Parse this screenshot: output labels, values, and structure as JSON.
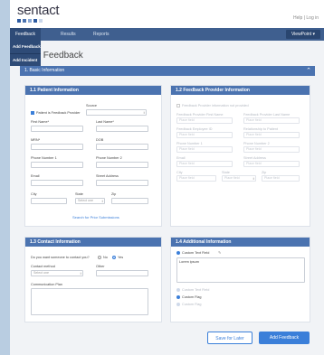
{
  "app": {
    "logo": "sentact",
    "top_links": "Help | Log in",
    "logo_colors": [
      "#2c5aa0",
      "#4b73b0",
      "#8aa9d6",
      "#2c5aa0",
      "#c9d6ea"
    ]
  },
  "nav": {
    "feedback": "Feedback",
    "results": "Results",
    "reports": "Reports",
    "viewpoint": "ViewPoint"
  },
  "dropdown": {
    "add_feedback": "Add Feedback",
    "add_incident": "Add Incident"
  },
  "page": {
    "title": "New Feedback",
    "section": "1.  Basic Information"
  },
  "patient": {
    "title": "1.1  Patient Information",
    "source_label": "Source",
    "patient_is_provider": "Patient is Feedback Provider",
    "first_name": "First Name*",
    "last_name": "Last Name*",
    "mrn": "MRN*",
    "dob": "DOB",
    "phone1": "Phone Number 1",
    "phone2": "Phone Number 2",
    "email": "Email",
    "street": "Street Address",
    "city": "City",
    "state": "State",
    "state_value": "Select one",
    "zip": "Zip",
    "search_link": "Search for Prior Submissions"
  },
  "provider": {
    "title": "1.2  Feedback Provider Information",
    "checkbox": "Feedback Provider information not provided",
    "first_name": "Feedback Provider First Name",
    "last_name": "Feedback Provider Last Name",
    "employee": "Feedback Employee ID",
    "relationship": "Relationship to Patient",
    "phone1": "Phone Number 1",
    "phone2": "Phone Number 2",
    "email": "Email",
    "street": "Street Address",
    "city": "City",
    "state": "State",
    "zip": "Zip",
    "placeholder": "Place field",
    "state_placeholder": "Place field"
  },
  "contact": {
    "title": "1.3  Contact Information",
    "question": "Do you want someone to contact you?",
    "no": "No",
    "yes": "Yes",
    "method": "Contact method",
    "method_value": "Select one",
    "other": "Other",
    "plan": "Communication Plan"
  },
  "additional": {
    "title": "1.4  Additional Information",
    "custom_text": "Custom Text Field",
    "textarea_value": "Lorem ipsum",
    "custom_text2": "Custom Text Field",
    "flag1": "Custom Flag",
    "flag2": "Custom Flag"
  },
  "actions": {
    "save_later": "Save for Later",
    "add_feedback": "Add Feedback"
  }
}
